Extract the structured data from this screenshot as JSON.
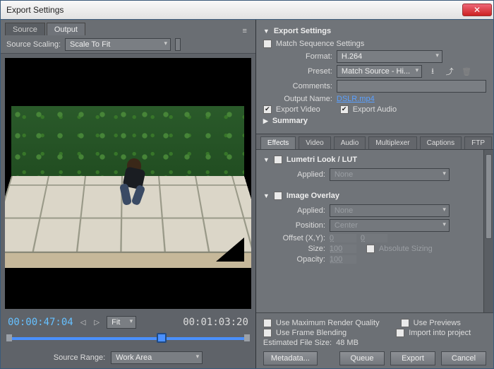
{
  "window": {
    "title": "Export Settings"
  },
  "left": {
    "tabs": [
      "Source",
      "Output"
    ],
    "active_tab": 1,
    "scale_label": "Source Scaling:",
    "scale_value": "Scale To Fit",
    "timecode_current": "00:00:47:04",
    "timecode_total": "00:01:03:20",
    "fit_label": "Fit",
    "source_range_label": "Source Range:",
    "source_range_value": "Work Area"
  },
  "export": {
    "header": "Export Settings",
    "match_seq": "Match Sequence Settings",
    "format_label": "Format:",
    "format_value": "H.264",
    "preset_label": "Preset:",
    "preset_value": "Match Source - Hi...",
    "comments_label": "Comments:",
    "comments_value": "",
    "outname_label": "Output Name:",
    "outname_link": "DSLR.mp4",
    "export_video": "Export Video",
    "export_audio": "Export Audio",
    "summary": "Summary"
  },
  "subtabs": [
    "Effects",
    "Video",
    "Audio",
    "Multiplexer",
    "Captions",
    "FTP"
  ],
  "subtabs_active": 0,
  "lumetri": {
    "header": "Lumetri Look / LUT",
    "applied_label": "Applied:",
    "applied_value": "None"
  },
  "overlay": {
    "header": "Image Overlay",
    "applied_label": "Applied:",
    "applied_value": "None",
    "position_label": "Position:",
    "position_value": "Center",
    "offset_label": "Offset (X,Y):",
    "offset_x": "0",
    "offset_y": "0",
    "size_label": "Size:",
    "size_value": "100",
    "abs_label": "Absolute Sizing",
    "opacity_label": "Opacity:",
    "opacity_value": "100"
  },
  "footer": {
    "max_quality": "Use Maximum Render Quality",
    "previews": "Use Previews",
    "frame_blend": "Use Frame Blending",
    "import": "Import into project",
    "est_label": "Estimated File Size:",
    "est_value": "48 MB",
    "metadata": "Metadata...",
    "queue": "Queue",
    "export": "Export",
    "cancel": "Cancel"
  }
}
